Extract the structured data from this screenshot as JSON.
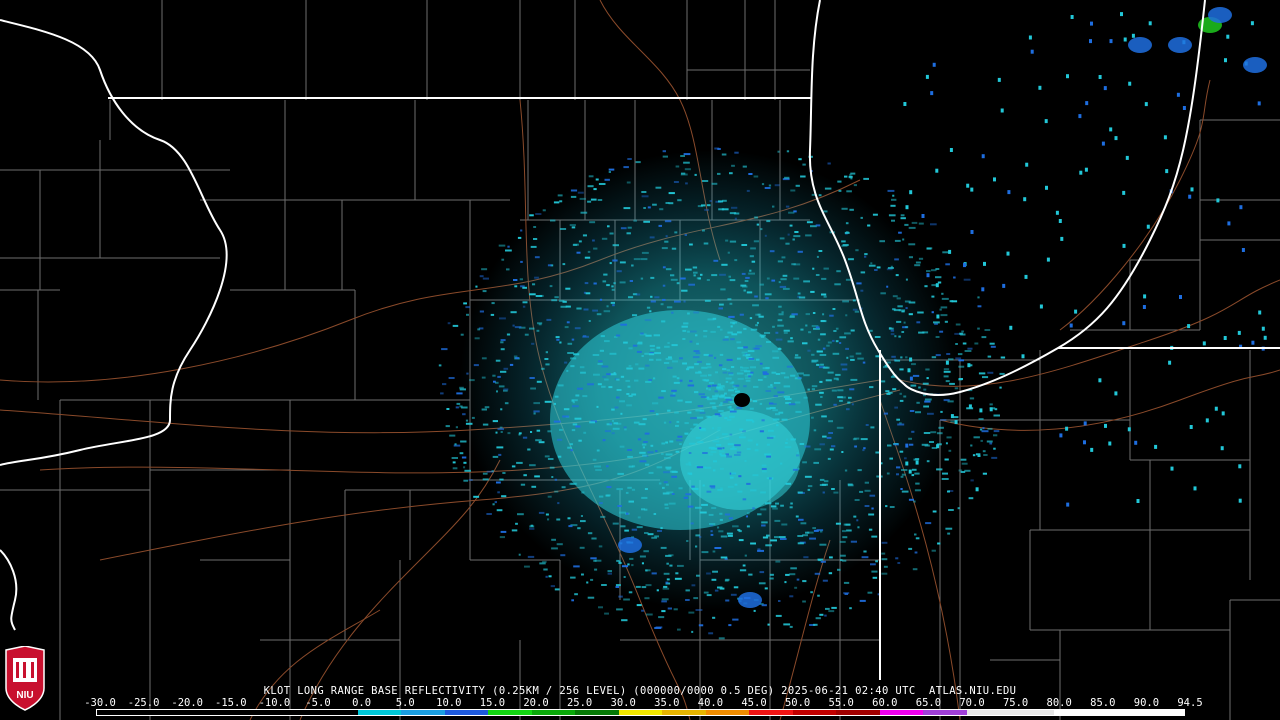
{
  "caption": "KLOT LONG RANGE BASE REFLECTIVITY (0.25KM / 256 LEVEL) (000000/0000 0.5 DEG) 2025-06-21 02:40 UTC  ATLAS.NIU.EDU",
  "logo_text": "NIU",
  "legend": {
    "ticks": [
      "-30.0",
      "-25.0",
      "-20.0",
      "-15.0",
      "-10.0",
      "-5.0",
      "0.0",
      "5.0",
      "10.0",
      "15.0",
      "20.0",
      "25.0",
      "30.0",
      "35.0",
      "40.0",
      "45.0",
      "50.0",
      "55.0",
      "60.0",
      "65.0",
      "70.0",
      "75.0",
      "80.0",
      "85.0",
      "90.0",
      "94.5"
    ],
    "colors": [
      "#000000",
      "#000000",
      "#000000",
      "#000000",
      "#000000",
      "#000000",
      "#00c8d8",
      "#1a9ee0",
      "#1e5adc",
      "#12d612",
      "#0aa80a",
      "#067a06",
      "#f2e600",
      "#e6b400",
      "#f08c00",
      "#f01414",
      "#c00000",
      "#a00000",
      "#f000f0",
      "#a040d8",
      "#e6e6e6",
      "#e6e6e6",
      "#ffffff",
      "#ffffff",
      "#ffffff"
    ]
  },
  "colors": {
    "background": "#000000",
    "county_lines": "#7a7a7a",
    "state_lines": "#ffffff",
    "highways": "#8a4a2a",
    "echo_light": "#22c8d8",
    "echo_mid": "#1e6ee0",
    "echo_strong": "#1ec81e"
  },
  "radar_site": "KLOT"
}
